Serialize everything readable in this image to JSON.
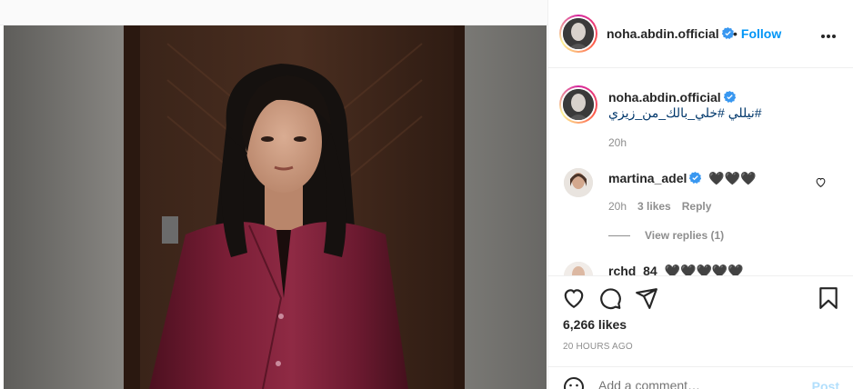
{
  "post": {
    "username": "noha.abdin.official",
    "follow_label": "Follow",
    "dot": "•",
    "caption": "#نيللي #خلي_بالك_من_زيزي",
    "caption_time": "20h",
    "likes": "6,266 likes",
    "posted_ago": "20 HOURS AGO"
  },
  "comments": [
    {
      "username": "martina_adel",
      "text": "🖤🖤🖤",
      "time": "20h",
      "likes": "3 likes",
      "reply_label": "Reply",
      "view_replies": "View replies (1)"
    },
    {
      "username": "rchd_84",
      "text": "🖤🖤🖤🖤🖤"
    }
  ],
  "add_comment": {
    "placeholder": "Add a comment…",
    "post_label": "Post"
  },
  "icons": {
    "verified": "verified-badge-icon",
    "more": "more-options-icon",
    "like": "heart-icon",
    "comment": "comment-icon",
    "share": "share-icon",
    "save": "bookmark-icon",
    "emoji": "emoji-icon"
  },
  "colors": {
    "accent": "#0095f6",
    "muted": "#8e8e8e",
    "text": "#262626",
    "caption_link": "#00376b"
  }
}
